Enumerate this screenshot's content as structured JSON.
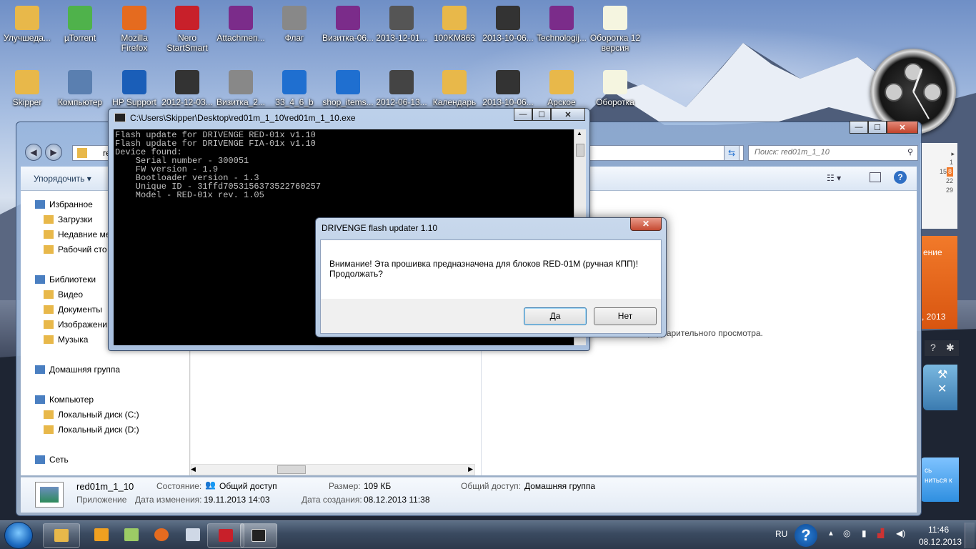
{
  "desktop_icons_row1": [
    {
      "label": "Улучшеда...",
      "color": "#e8b84a"
    },
    {
      "label": "µTorrent",
      "color": "#4fb24b"
    },
    {
      "label": "Mozilla Firefox",
      "color": "#e56b1f"
    },
    {
      "label": "Nero StartSmart",
      "color": "#c8202a"
    },
    {
      "label": "Attachmen...",
      "color": "#7b2c8a"
    },
    {
      "label": "Флаг",
      "color": "#888888"
    },
    {
      "label": "Визитка-06...",
      "color": "#7b2c8a"
    },
    {
      "label": "2013-12-01...",
      "color": "#555555"
    },
    {
      "label": "100KM863",
      "color": "#e8b84a"
    },
    {
      "label": "2013-10-06...",
      "color": "#333333"
    },
    {
      "label": "Technologij...",
      "color": "#7b2c8a"
    },
    {
      "label": "Оборотка 12 версия",
      "color": "#f5f5e0"
    }
  ],
  "desktop_icons_row2": [
    {
      "label": "Skipper",
      "color": "#e8b84a"
    },
    {
      "label": "Компьютер",
      "color": "#5a7fb0"
    },
    {
      "label": "HP Support",
      "color": "#1a5eb8"
    },
    {
      "label": "2012-12-03...",
      "color": "#333333"
    },
    {
      "label": "Визитка_2...",
      "color": "#888888"
    },
    {
      "label": "33_4_6_b",
      "color": "#1f6fd0"
    },
    {
      "label": "shop_items...",
      "color": "#1f6fd0"
    },
    {
      "label": "2012-06-13...",
      "color": "#444444"
    },
    {
      "label": "Календарь",
      "color": "#e8b84a"
    },
    {
      "label": "2013-10-06...",
      "color": "#333333"
    },
    {
      "label": "Арское",
      "color": "#e8b84a"
    },
    {
      "label": "Оборотка",
      "color": "#f5f5e0"
    }
  ],
  "explorer": {
    "address_text": "re",
    "search_placeholder": "Поиск: red01m_1_10",
    "organize_label": "Упорядочить ▾",
    "nav": [
      {
        "label": "Избранное",
        "type": "header"
      },
      {
        "label": "Загрузки",
        "type": "item"
      },
      {
        "label": "Недавние ме",
        "type": "item"
      },
      {
        "label": "Рабочий сто",
        "type": "item"
      },
      {
        "label": "Библиотеки",
        "type": "header"
      },
      {
        "label": "Видео",
        "type": "item"
      },
      {
        "label": "Документы",
        "type": "item"
      },
      {
        "label": "Изображени",
        "type": "item"
      },
      {
        "label": "Музыка",
        "type": "item"
      },
      {
        "label": "Домашняя группа",
        "type": "header"
      },
      {
        "label": "Компьютер",
        "type": "header"
      },
      {
        "label": "Локальный диск (C:)",
        "type": "item"
      },
      {
        "label": "Локальный диск (D:)",
        "type": "item"
      },
      {
        "label": "Сеть",
        "type": "header"
      }
    ],
    "preview_message": "предварительного просмотра.",
    "details": {
      "file_name": "red01m_1_10",
      "file_type": "Приложение",
      "state_label": "Состояние:",
      "state_value": "Общий доступ",
      "modified_label": "Дата изменения:",
      "modified_value": "19.11.2013 14:03",
      "size_label": "Размер:",
      "size_value": "109 КБ",
      "created_label": "Дата создания:",
      "created_value": "08.12.2013 11:38",
      "shared_label": "Общий доступ:",
      "shared_value": "Домашняя группа"
    }
  },
  "console": {
    "title": "C:\\Users\\Skipper\\Desktop\\red01m_1_10\\red01m_1_10.exe",
    "lines": [
      "Flash update for DRIVENGE RED-01x v1.10",
      "Flash update for DRIVENGE FIA-01x v1.10",
      "Device found:",
      "    Serial number - 300051",
      "    FW version - 1.9",
      "    Bootloader version - 1.3",
      "    Unique ID - 31ffd705315637352276025​7",
      "    Model - RED-01x rev. 1.05"
    ]
  },
  "dialog": {
    "title": "DRIVENGE flash updater 1.10",
    "message_line1": "Внимание! Эта прошивка предназначена для блоков RED-01M (ручная КПП)!",
    "message_line2": "Продолжать?",
    "yes_label": "Да",
    "no_label": "Нет"
  },
  "gadgets": {
    "calendar_rows": [
      "1",
      "8",
      "15",
      "22",
      "29"
    ],
    "orange_text_top": "ение",
    "orange_text_bottom": ", 2013",
    "blue_text": "сь ниться к"
  },
  "taskbar": {
    "language": "RU",
    "time": "11:46",
    "date": "08.12.2013"
  }
}
